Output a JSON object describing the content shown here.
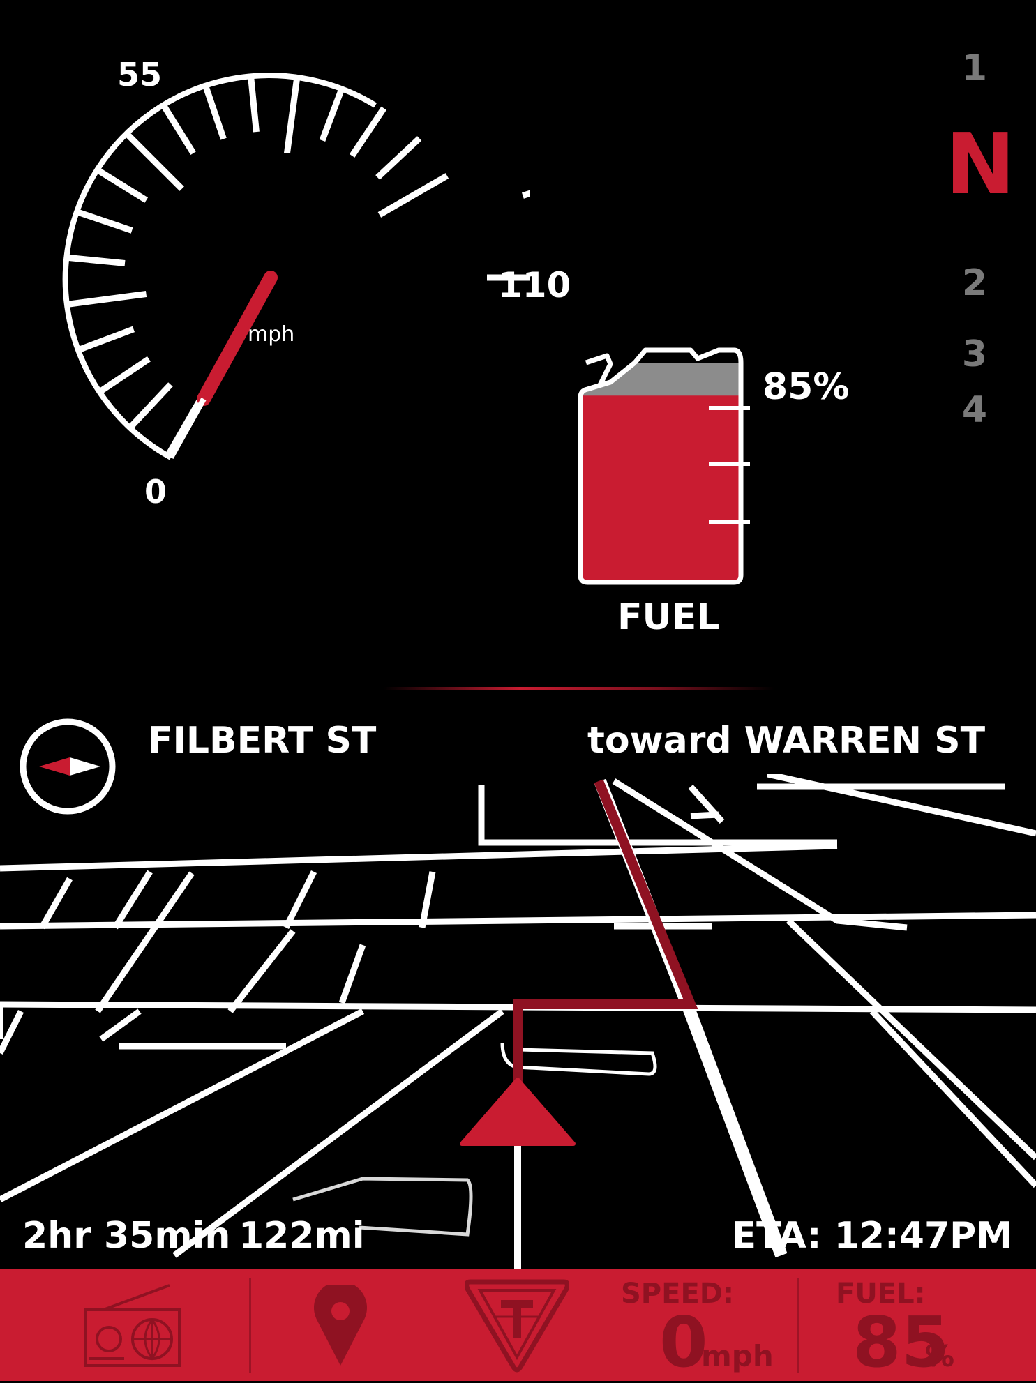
{
  "speedometer": {
    "min_label": "0",
    "mid_label": "55",
    "max_label": "110",
    "unit": "mph",
    "current_speed": 0,
    "needle_color": "#c91c31"
  },
  "gears": {
    "items": [
      "1",
      "N",
      "2",
      "3",
      "4"
    ],
    "active": "N",
    "active_color": "#c91c31"
  },
  "fuel_gauge": {
    "percent_label": "85%",
    "level": 0.85,
    "label": "FUEL",
    "fill_color": "#c91c31"
  },
  "navigation": {
    "compass_icon": "compass-icon",
    "street": "FILBERT ST",
    "toward": "toward WARREN ST",
    "duration": "2hr 35min",
    "distance": "122mi",
    "eta": "ETA: 12:47PM",
    "route_color": "#8f1222",
    "position_marker_icon": "position-arrow-icon"
  },
  "bottom_bar": {
    "background": "#c91c31",
    "radio_icon": "radio-icon",
    "location_icon": "location-pin-icon",
    "logo_icon": "triumph-logo-icon",
    "speed_title": "SPEED:",
    "speed_value": "0",
    "speed_unit": "mph",
    "fuel_title": "FUEL:",
    "fuel_value": "85",
    "fuel_unit": "%"
  }
}
